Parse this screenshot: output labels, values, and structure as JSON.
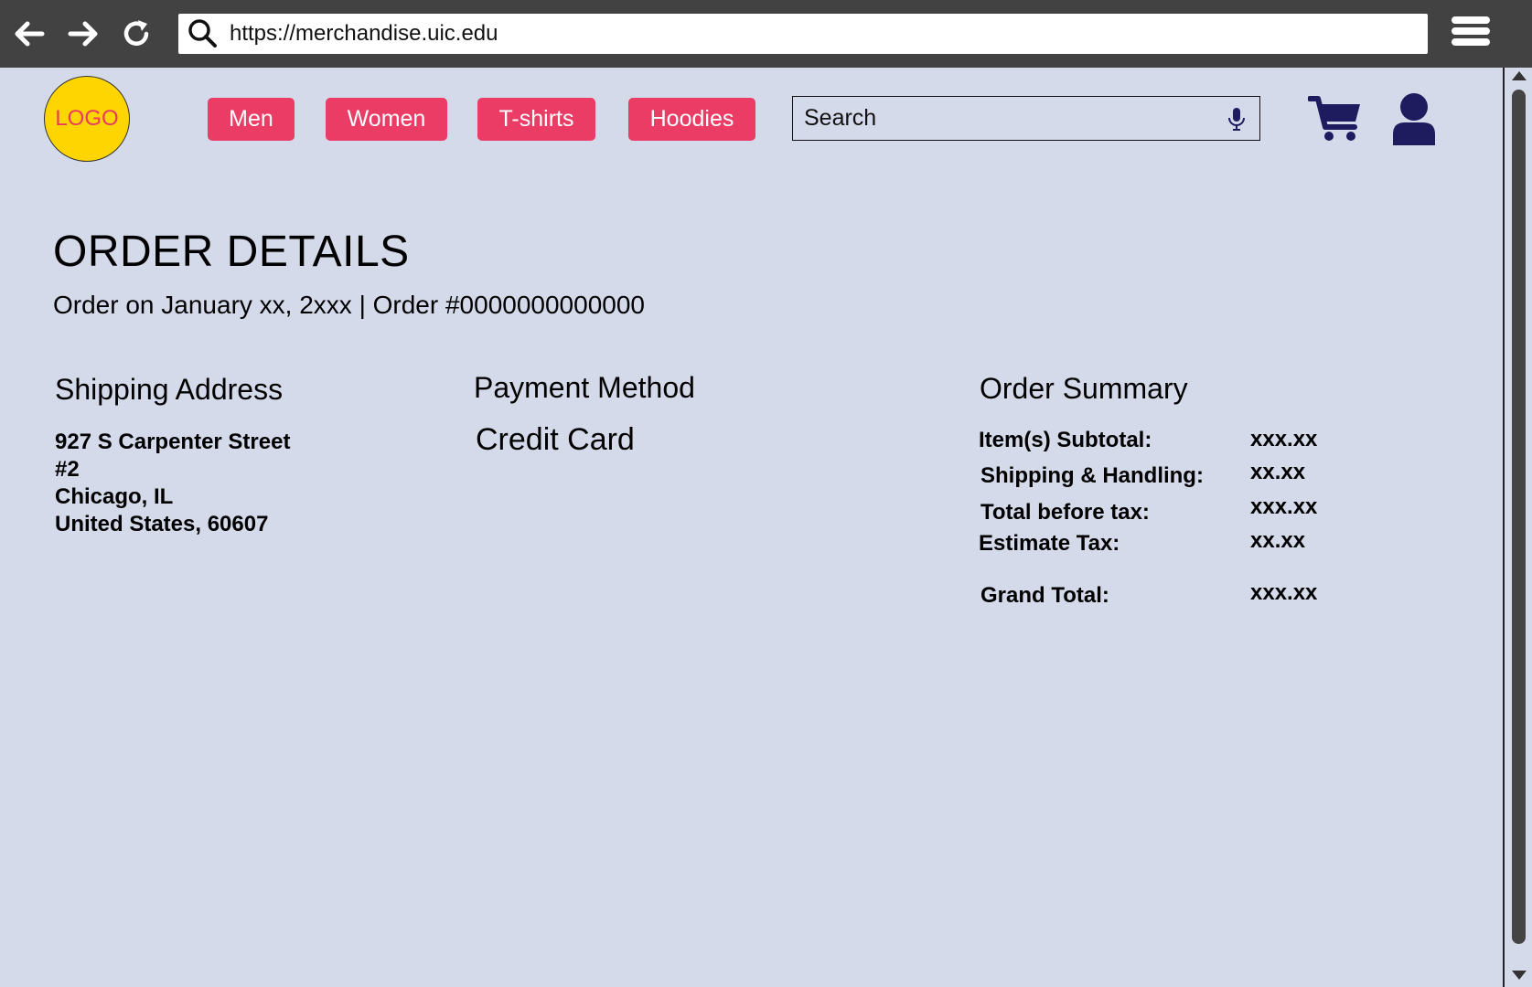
{
  "browser": {
    "url": "https://merchandise.uic.edu"
  },
  "header": {
    "logo_text": "LOGO",
    "nav": [
      "Men",
      "Women",
      "T-shirts",
      "Hoodies"
    ],
    "search_placeholder": "Search"
  },
  "colors": {
    "page_background": "#d5daea",
    "nav_button": "#ea3c64",
    "logo_fill": "#ffd500",
    "icon_navy": "#1e1b5e",
    "chrome": "#424242"
  },
  "order": {
    "title": "ORDER DETAILS",
    "meta": "Order on January xx, 2xxx | Order #0000000000000"
  },
  "shipping": {
    "title": "Shipping Address",
    "lines": [
      "927 S Carpenter Street",
      "#2",
      "Chicago, IL",
      "United States, 60607"
    ]
  },
  "payment": {
    "title": "Payment Method",
    "value": "Credit Card"
  },
  "summary": {
    "title": "Order Summary",
    "rows": [
      {
        "label": "Item(s) Subtotal:",
        "value": "xxx.xx"
      },
      {
        "label": "Shipping & Handling:",
        "value": "xx.xx"
      },
      {
        "label": "Total before tax:",
        "value": "xxx.xx"
      },
      {
        "label": "Estimate Tax:",
        "value": "xx.xx"
      },
      {
        "label": "Grand Total:",
        "value": "xxx.xx"
      }
    ]
  }
}
